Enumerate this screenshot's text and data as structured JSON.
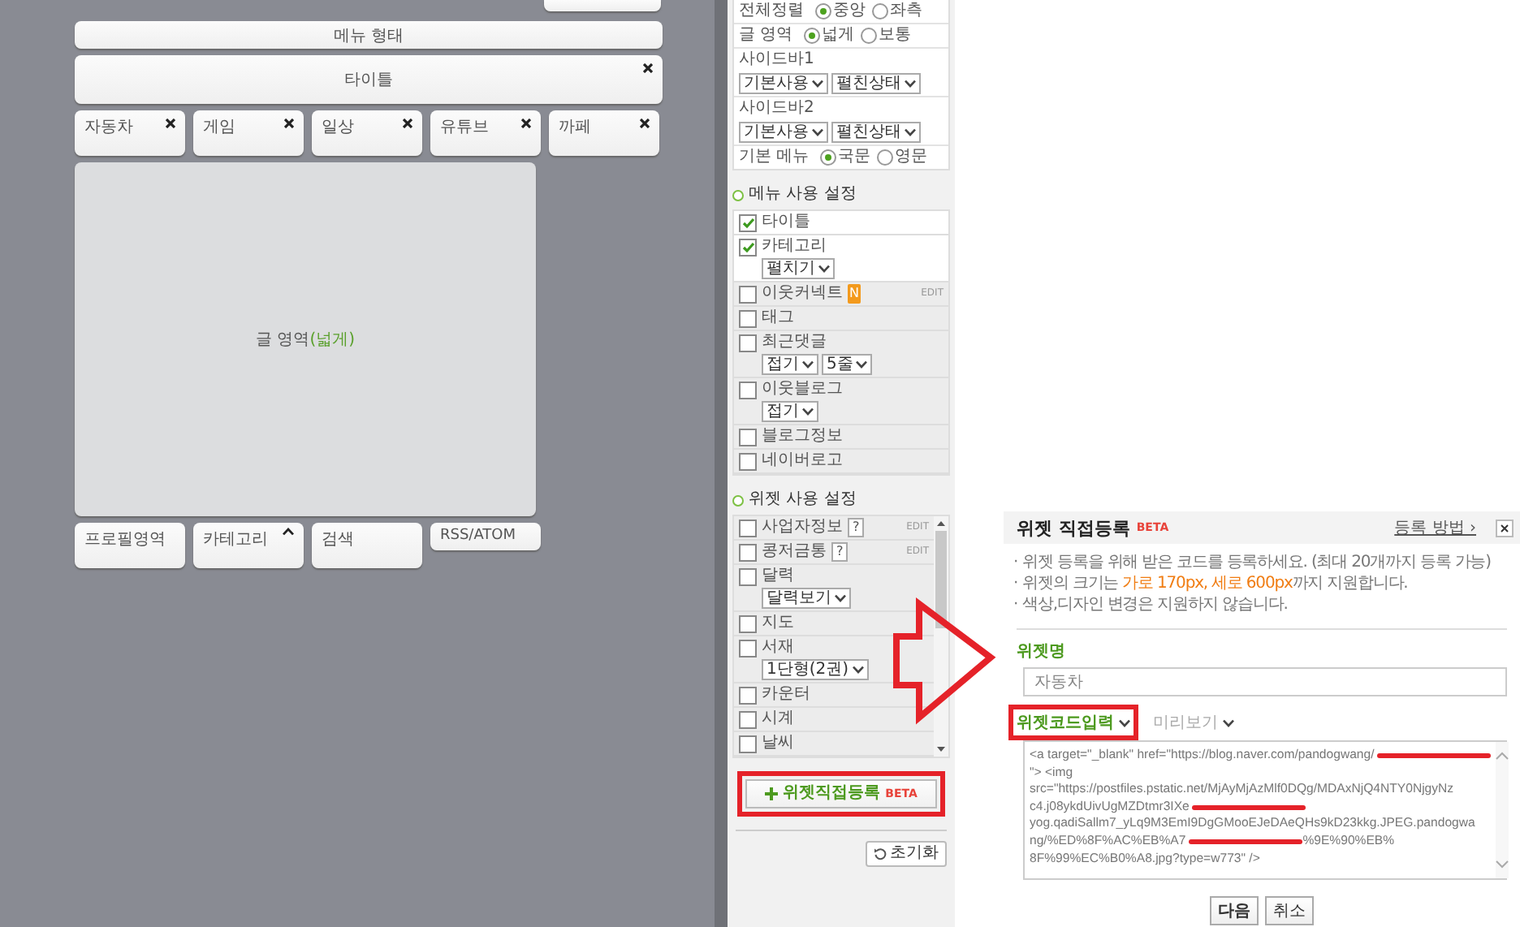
{
  "canvas": {
    "menu_bar": "메뉴 형태",
    "title_block": {
      "label": "타이틀"
    },
    "categories": [
      {
        "label": "자동차"
      },
      {
        "label": "게임"
      },
      {
        "label": "일상"
      },
      {
        "label": "유튜브"
      },
      {
        "label": "까페"
      }
    ],
    "content_area": {
      "label": "글 영역",
      "width_label": "(넓게)"
    },
    "bottom_widgets": [
      {
        "label": "프로필영역",
        "kind": "tall",
        "collapsible": false
      },
      {
        "label": "카테고리",
        "kind": "tall",
        "collapsible": true
      },
      {
        "label": "검색",
        "kind": "tall",
        "collapsible": false
      },
      {
        "label": "RSS/ATOM",
        "kind": "short",
        "collapsible": false
      }
    ]
  },
  "layout_settings": [
    {
      "kind": "radio",
      "label": "전체정렬",
      "options": [
        {
          "label": "중앙",
          "selected": true
        },
        {
          "label": "좌측",
          "selected": false
        }
      ]
    },
    {
      "kind": "radio",
      "label": "글 영역",
      "options": [
        {
          "label": "넓게",
          "selected": true
        },
        {
          "label": "보통",
          "selected": false
        }
      ]
    },
    {
      "kind": "selects",
      "label": "사이드바1",
      "selects": [
        "기본사용",
        "펼친상태"
      ]
    },
    {
      "kind": "selects",
      "label": "사이드바2",
      "selects": [
        "기본사용",
        "펼친상태"
      ]
    },
    {
      "kind": "radio",
      "label": "기본 메뉴",
      "options": [
        {
          "label": "국문",
          "selected": true
        },
        {
          "label": "영문",
          "selected": false
        }
      ]
    }
  ],
  "menu_settings": {
    "title": "메뉴 사용 설정",
    "items": [
      {
        "label": "타이틀",
        "checked": true
      },
      {
        "label": "카테고리",
        "checked": true,
        "selects": [
          "펼치기"
        ]
      },
      {
        "label": "이웃커넥트",
        "checked": false,
        "badge": "N",
        "edit": "EDIT"
      },
      {
        "label": "태그",
        "checked": false
      },
      {
        "label": "최근댓글",
        "checked": false,
        "selects": [
          "접기",
          "5줄"
        ]
      },
      {
        "label": "이웃블로그",
        "checked": false,
        "selects": [
          "접기"
        ]
      },
      {
        "label": "블로그정보",
        "checked": false
      },
      {
        "label": "네이버로고",
        "checked": false
      }
    ]
  },
  "widget_settings": {
    "title": "위젯 사용 설정",
    "items": [
      {
        "label": "사업자정보",
        "checked": false,
        "help": "?",
        "edit": "EDIT"
      },
      {
        "label": "콩저금통",
        "checked": false,
        "help": "?",
        "edit": "EDIT"
      },
      {
        "label": "달력",
        "checked": false,
        "selects": [
          "달력보기"
        ]
      },
      {
        "label": "지도",
        "checked": false
      },
      {
        "label": "서재",
        "checked": false,
        "selects": [
          "1단형(2권)"
        ]
      },
      {
        "label": "카운터",
        "checked": false
      },
      {
        "label": "시계",
        "checked": false
      },
      {
        "label": "날씨",
        "checked": false
      }
    ],
    "add_button": {
      "label": "위젯직접등록",
      "badge": "BETA",
      "highlighted": true
    },
    "reset_button": "초기화"
  },
  "dialog": {
    "title": "위젯 직접등록",
    "badge": "BETA",
    "help_link": "등록 방법 ›",
    "notes": [
      {
        "bullet": "·",
        "text": "위젯 등록을 위해 받은 코드를 등록하세요. (최대 20개까지 등록 가능)"
      },
      {
        "bullet": "·",
        "text": "위젯의 크기는 ",
        "highlight": "가로 170px, 세로 600px",
        "after": "까지 지원합니다."
      },
      {
        "bullet": "·",
        "text": "색상,디자인 변경은 지원하지 않습니다."
      }
    ],
    "name_label": "위젯명",
    "name_value": "자동차",
    "tabs": [
      {
        "label": "위젯코드입력",
        "selected": true,
        "highlighted": true
      },
      {
        "label": "미리보기",
        "selected": false,
        "highlighted": false
      }
    ],
    "code_lines": [
      [
        {
          "kind": "text",
          "text": "<a target=\"_blank\" href=\"https://blog.naver.com/pandogwang/"
        },
        {
          "kind": "redaction"
        }
      ],
      [
        {
          "kind": "text",
          "text": "\"> <img"
        }
      ],
      [
        {
          "kind": "text",
          "text": "src=\"https://postfiles.pstatic.net/MjAyMjAzMlf0DQg/MDAxNjQ4NTY0NjgyNz"
        }
      ],
      [
        {
          "kind": "text",
          "text": "c4.j08ykdUivUgMZDtmr3IXe"
        },
        {
          "kind": "redaction"
        }
      ],
      [
        {
          "kind": "text",
          "text": "yog.qadiSallm7_yLq9M3EmI9DgGMooEJeDAeQHs9kD23kkg.JPEG.pandogwa"
        }
      ],
      [
        {
          "kind": "text",
          "text": "ng/%ED%8F%AC%EB%A7"
        },
        {
          "kind": "redaction"
        },
        {
          "kind": "text",
          "text": "%9E%90%EB%"
        }
      ],
      [
        {
          "kind": "text",
          "text": "8F%99%EC%B0%A8.jpg?type=w773\" />"
        }
      ]
    ],
    "buttons": [
      {
        "label": "다음",
        "kind": "primary"
      },
      {
        "label": "취소",
        "kind": "secondary"
      }
    ]
  },
  "annotations": [
    {
      "kind": "arrow"
    }
  ]
}
